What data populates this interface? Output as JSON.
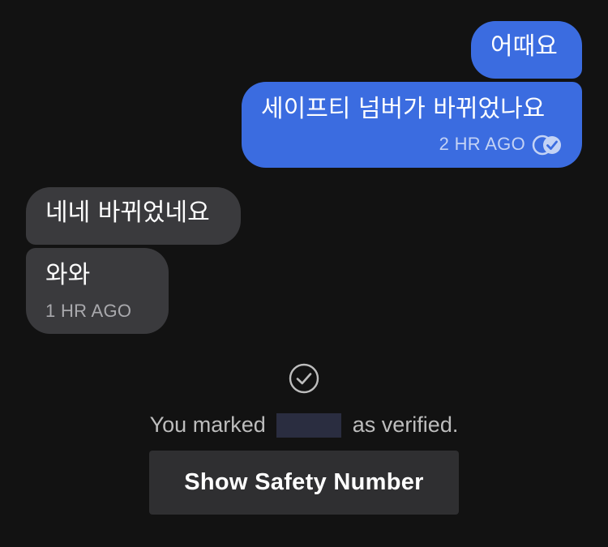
{
  "conversation": {
    "messages": [
      {
        "direction": "outgoing",
        "text": "어때요"
      },
      {
        "direction": "outgoing",
        "text": "세이프티 넘버가 바뀌었나요",
        "timestamp": "2 HR AGO",
        "status_icon": "delivered-check-icon"
      },
      {
        "direction": "incoming",
        "text": "네네 바뀌었네요"
      },
      {
        "direction": "incoming",
        "text": "와와",
        "timestamp": "1 HR AGO"
      }
    ]
  },
  "verification": {
    "icon": "check-circle-icon",
    "prefix": "You marked",
    "suffix": "as verified.",
    "button_label": "Show Safety Number"
  },
  "colors": {
    "background": "#121212",
    "outgoing_bubble": "#3b6ce0",
    "incoming_bubble": "#3a3a3d",
    "button_bg": "#2f2f31"
  }
}
